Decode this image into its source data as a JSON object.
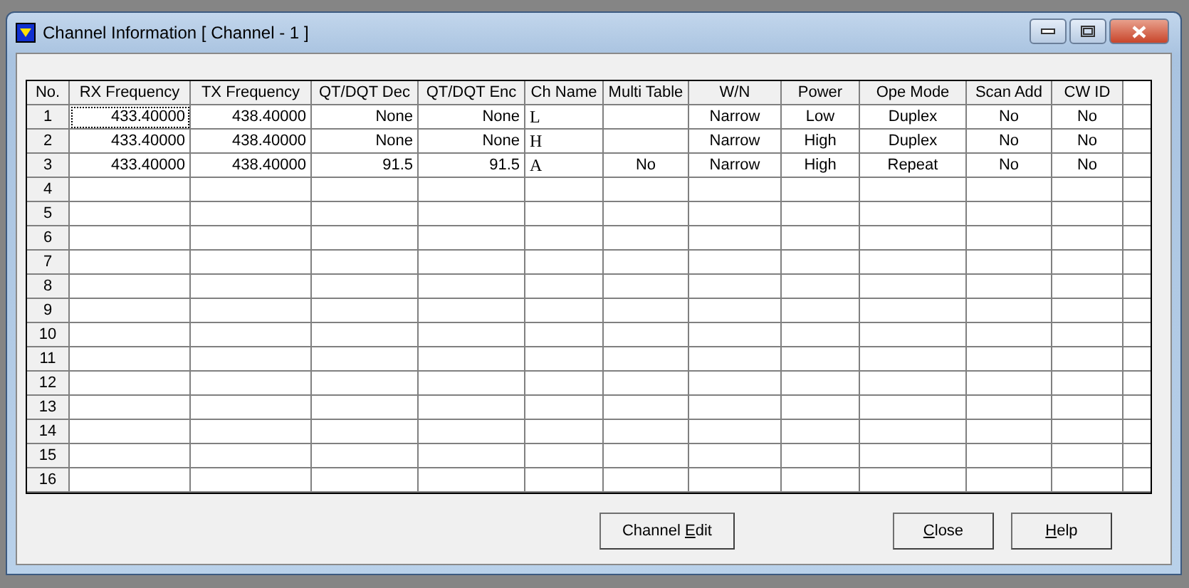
{
  "window": {
    "title": "Channel Information [ Channel - 1 ]"
  },
  "table": {
    "columns": [
      "No.",
      "RX Frequency",
      "TX Frequency",
      "QT/DQT Dec",
      "QT/DQT Enc",
      "Ch Name",
      "Multi Table",
      "W/N",
      "Power",
      "Ope Mode",
      "Scan Add",
      "CW ID"
    ],
    "rows": [
      {
        "no": "1",
        "cells": [
          {
            "text": "433.40000",
            "focused": true
          },
          {
            "text": "438.40000",
            "focused": false
          },
          {
            "text": "None",
            "focused": false
          },
          {
            "text": "None",
            "focused": false
          },
          {
            "text": "L",
            "focused": false
          },
          {
            "focused": false
          },
          {
            "text": "Narrow",
            "focused": false
          },
          {
            "text": "Low",
            "focused": false
          },
          {
            "text": "Duplex",
            "focused": false
          },
          {
            "text": "No",
            "focused": false
          },
          {
            "text": "No",
            "focused": false
          }
        ]
      },
      {
        "no": "2",
        "cells": [
          {
            "text": "433.40000",
            "focused": false
          },
          {
            "text": "438.40000",
            "focused": false
          },
          {
            "text": "None",
            "focused": false
          },
          {
            "text": "None",
            "focused": false
          },
          {
            "text": "H",
            "focused": false
          },
          {
            "focused": false
          },
          {
            "text": "Narrow",
            "focused": false
          },
          {
            "text": "High",
            "focused": false
          },
          {
            "text": "Duplex",
            "focused": false
          },
          {
            "text": "No",
            "focused": false
          },
          {
            "text": "No",
            "focused": false
          }
        ]
      },
      {
        "no": "3",
        "cells": [
          {
            "text": "433.40000",
            "focused": false
          },
          {
            "text": "438.40000",
            "focused": false
          },
          {
            "text": "91.5",
            "focused": false
          },
          {
            "text": "91.5",
            "focused": false
          },
          {
            "text": "A",
            "focused": false
          },
          {
            "text": "No",
            "focused": false
          },
          {
            "text": "Narrow",
            "focused": false
          },
          {
            "text": "High",
            "focused": false
          },
          {
            "text": "Repeat",
            "focused": false
          },
          {
            "text": "No",
            "focused": false
          },
          {
            "text": "No",
            "focused": false
          }
        ]
      },
      {
        "no": "4"
      },
      {
        "no": "5"
      },
      {
        "no": "6"
      },
      {
        "no": "7"
      },
      {
        "no": "8"
      },
      {
        "no": "9"
      },
      {
        "no": "10"
      },
      {
        "no": "11"
      },
      {
        "no": "12"
      },
      {
        "no": "13"
      },
      {
        "no": "14"
      },
      {
        "no": "15"
      },
      {
        "no": "16"
      }
    ]
  },
  "buttons": [
    {
      "kind": "edit",
      "pre": "Channel ",
      "key": "E",
      "post": "dit"
    },
    {
      "kind": "close",
      "key": "C",
      "post": "lose"
    },
    {
      "kind": "help",
      "key": "H",
      "post": "elp"
    }
  ]
}
